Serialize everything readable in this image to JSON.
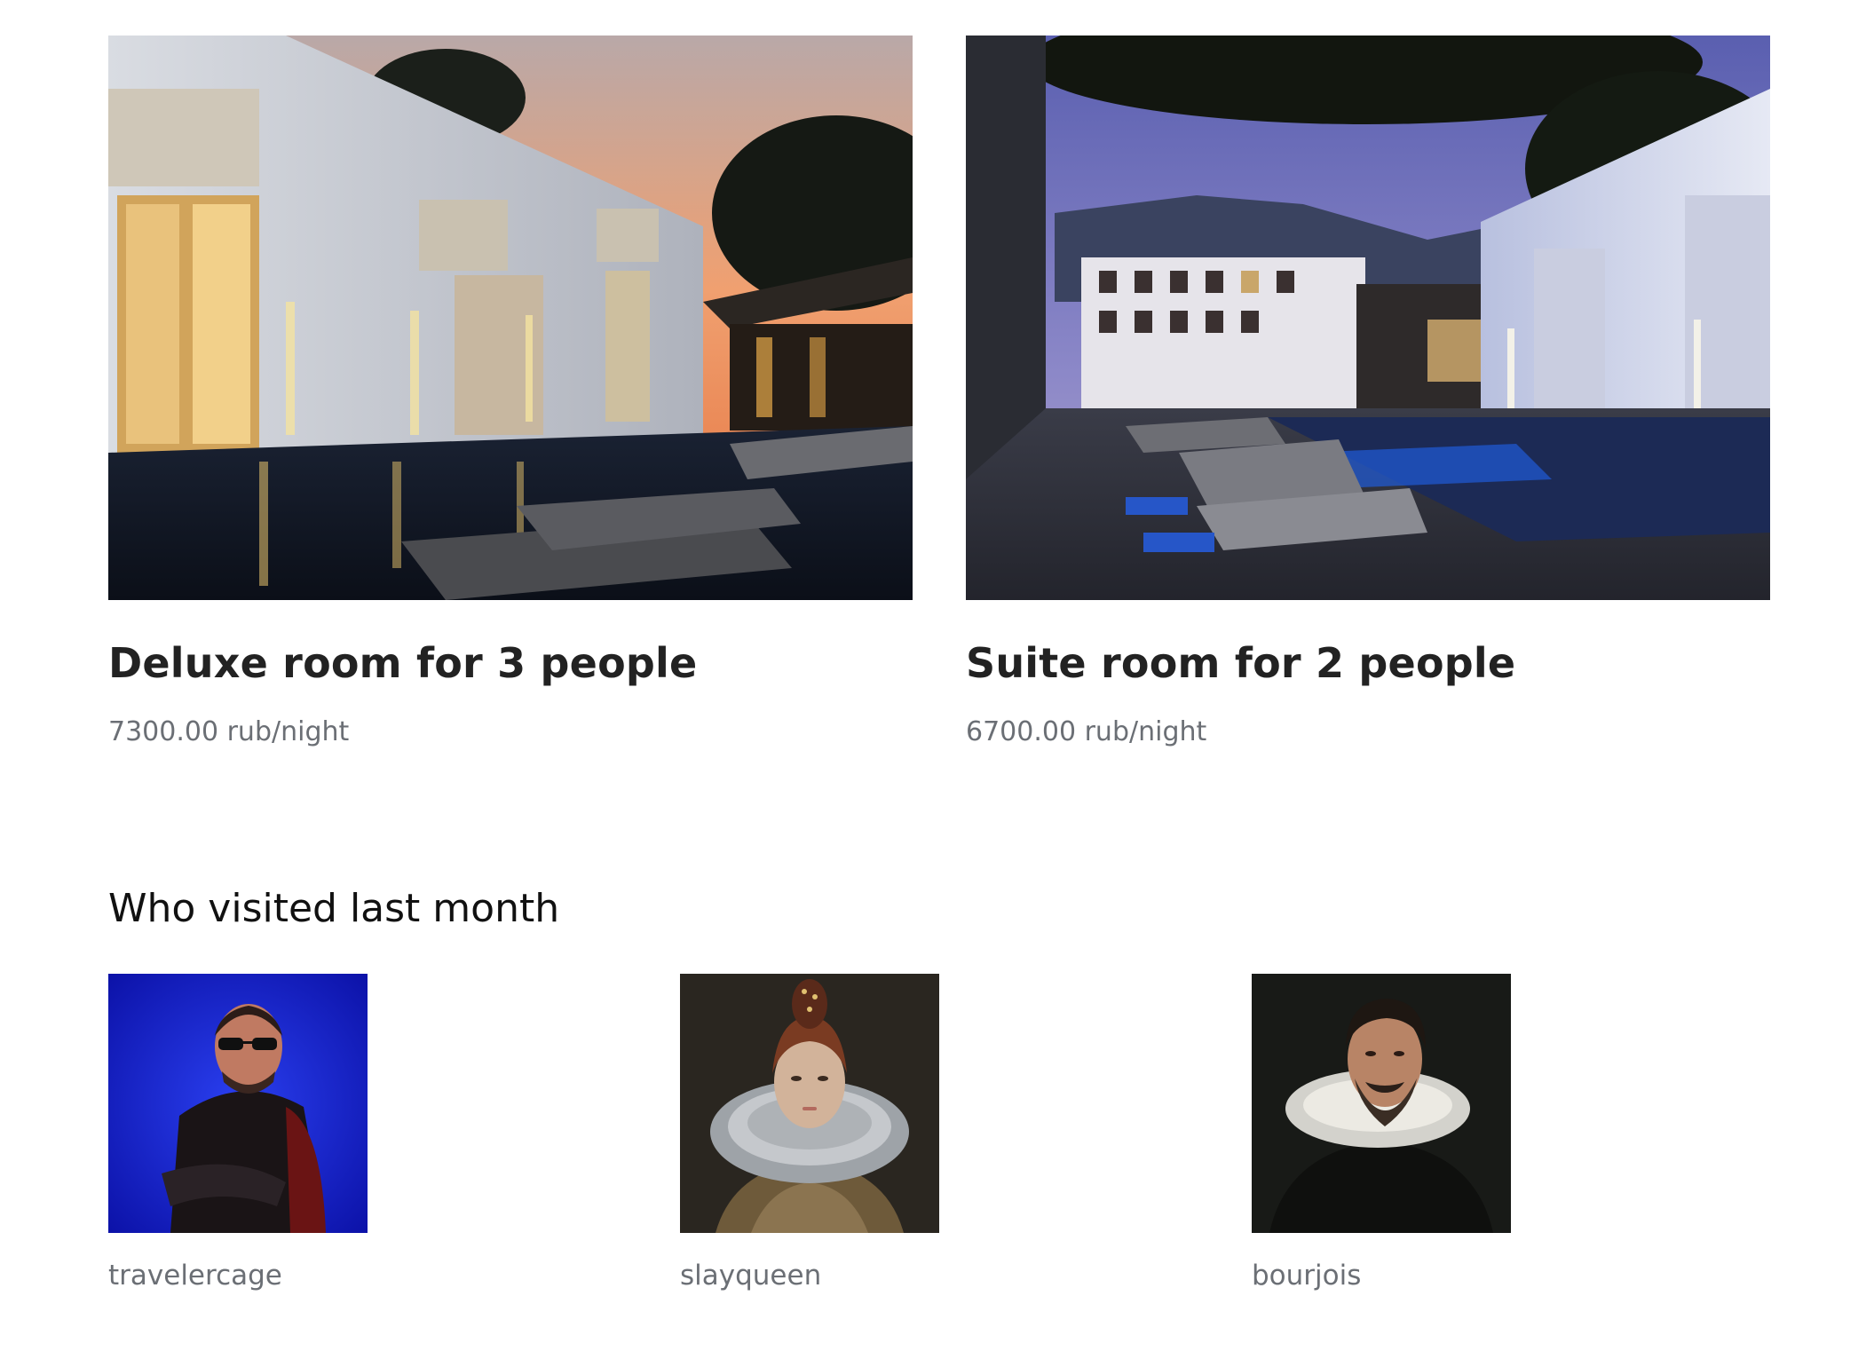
{
  "rooms": [
    {
      "title": "Deluxe room for 3 people",
      "price": "7300.00 rub/night",
      "photo": "hotel-pool-sunset-photo"
    },
    {
      "title": "Suite room for 2 people",
      "price": "6700.00 rub/night",
      "photo": "hotel-pool-dusk-photo"
    }
  ],
  "visitors_section": {
    "title": "Who visited last month",
    "visitors": [
      {
        "username": "travelercage",
        "avatar": "man-sunglasses-leather-jacket-photo"
      },
      {
        "username": "slayqueen",
        "avatar": "woman-ruff-collar-portrait"
      },
      {
        "username": "bourjois",
        "avatar": "bearded-man-ruff-collar-portrait"
      }
    ]
  },
  "colors": {
    "text": "#222222",
    "muted": "#6b6f75",
    "background": "#ffffff"
  }
}
